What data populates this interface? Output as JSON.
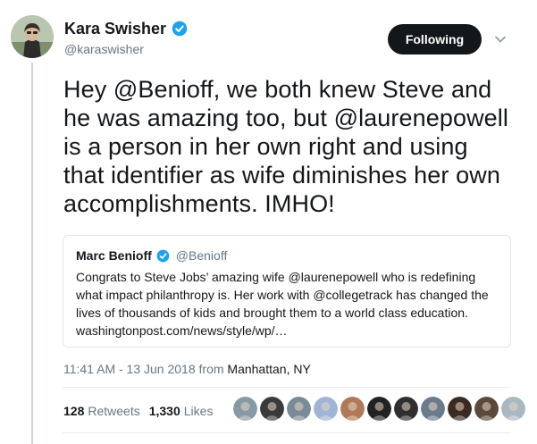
{
  "author": {
    "name": "Kara Swisher",
    "handle": "@karaswisher",
    "verified": true,
    "avatar_icon": "profile-photo-avatar"
  },
  "follow_button": {
    "label": "Following"
  },
  "tweet": {
    "lines": [
      "Hey @Benioff, we both knew Steve and",
      "he was amazing too, but @laurenepowell",
      "is a person in her own right and using",
      "that identifier as wife diminishes her own",
      "accomplishments. IMHO!"
    ]
  },
  "quoted_tweet": {
    "name": "Marc Benioff",
    "handle": "@Benioff",
    "verified": true,
    "lines": [
      "Congrats to Steve Jobs’ amazing wife @laurenepowell who is redefining",
      "what impact philanthropy is.  Her work with @collegetrack has changed the",
      "lives of thousands of kids and brought them to a world class education.",
      "washingtonpost.com/news/style/wp/…"
    ]
  },
  "meta": {
    "timestamp": "11:41 AM - 13 Jun 2018 from ",
    "location": "Manhattan, NY"
  },
  "stats": {
    "retweets_count": "128",
    "retweets_label": "Retweets",
    "likes_count": "1,330",
    "likes_label": "Likes"
  },
  "likers": [
    {
      "icon": "liker-avatar-1-icon",
      "color": "#8899a6"
    },
    {
      "icon": "liker-avatar-2-icon",
      "color": "#3a3a3a"
    },
    {
      "icon": "liker-avatar-3-icon",
      "color": "#7a8a99"
    },
    {
      "icon": "liker-avatar-4-icon",
      "color": "#9fb4d6"
    },
    {
      "icon": "liker-avatar-5-icon",
      "color": "#b07a5a"
    },
    {
      "icon": "liker-avatar-6-icon",
      "color": "#222222"
    },
    {
      "icon": "liker-avatar-7-icon",
      "color": "#2f2f2f"
    },
    {
      "icon": "liker-avatar-8-icon",
      "color": "#6a7b8c"
    },
    {
      "icon": "liker-avatar-9-icon",
      "color": "#3b2a22"
    },
    {
      "icon": "liker-avatar-10-icon",
      "color": "#5a4a3a"
    },
    {
      "icon": "liker-avatar-11-icon",
      "color": "#aab8c2"
    }
  ],
  "colors": {
    "verified_blue": "#1da1f2",
    "secondary_text": "#657786",
    "button_bg": "#14171a"
  }
}
